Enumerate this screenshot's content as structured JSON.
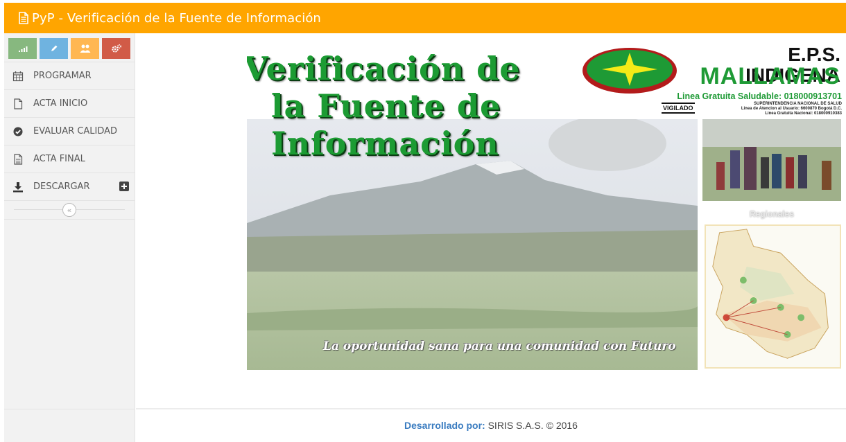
{
  "header": {
    "title": "PyP - Verificación de la Fuente de Información",
    "icon": "document-icon",
    "color": "#ffa500"
  },
  "shortcuts": [
    {
      "icon": "signal-icon",
      "color": "#87b87f"
    },
    {
      "icon": "pencil-icon",
      "color": "#6fb3e0"
    },
    {
      "icon": "users-icon",
      "color": "#ffb752"
    },
    {
      "icon": "cogs-icon",
      "color": "#d15b47"
    }
  ],
  "sidebar": {
    "items": [
      {
        "label": "PROGRAMAR",
        "icon": "calendar-icon"
      },
      {
        "label": "ACTA INICIO",
        "icon": "file-icon"
      },
      {
        "label": "EVALUAR CALIDAD",
        "icon": "check-circle-icon"
      },
      {
        "label": "ACTA FINAL",
        "icon": "file-text-icon"
      },
      {
        "label": "DESCARGAR",
        "icon": "download-icon"
      }
    ],
    "collapse_icon": "double-chevron-left-icon"
  },
  "banner": {
    "title_line1": "Verificación de",
    "title_line2": "la Fuente de",
    "title_line3": "Información",
    "eps_name": "E.P.S. INDIGENA",
    "eps_sub": "MALLAMAS",
    "phone": "Linea Gratuita Saludable: 018000913701",
    "vigilado": "VIGILADO",
    "supersalud_line1": "SUPERINTENDENCIA NACIONAL DE SALUD",
    "supersalud_line2": "Linea de Atencion al Usuario: 6600870 Bogotá D.C.",
    "supersalud_line3": "Linea Gratuita Nacional: 018000910383",
    "regionales": "Regionales",
    "tagline": "La oportunidad sana para una comunidad con Futuro"
  },
  "footer": {
    "label": "Desarrollado por:",
    "text": "SIRIS S.A.S. © 2016"
  }
}
